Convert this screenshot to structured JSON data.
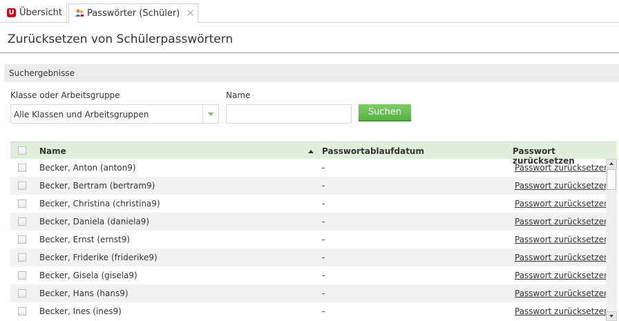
{
  "tabs": {
    "overview_label": "Übersicht",
    "passwords_label": "Passwörter (Schüler)",
    "close_symbol": "✕"
  },
  "page_title": "Zurücksetzen von Schülerpasswörtern",
  "section_title": "Suchergebnisse",
  "filter": {
    "class_label": "Klasse oder Arbeitsgruppe",
    "class_value": "Alle Klassen und Arbeitsgruppen",
    "name_label": "Name",
    "name_value": "",
    "search_button": "Suchen"
  },
  "grid": {
    "columns": {
      "name": "Name",
      "expiry": "Passwortablaufdatum",
      "reset": "Passwort zurücksetzen"
    },
    "rows": [
      {
        "name": "Becker, Anton (anton9)",
        "expiry": "-",
        "action": "Passwort zurücksetzen"
      },
      {
        "name": "Becker, Bertram (bertram9)",
        "expiry": "-",
        "action": "Passwort zurücksetzen"
      },
      {
        "name": "Becker, Christina (christina9)",
        "expiry": "-",
        "action": "Passwort zurücksetzen"
      },
      {
        "name": "Becker, Daniela (daniela9)",
        "expiry": "-",
        "action": "Passwort zurücksetzen"
      },
      {
        "name": "Becker, Ernst (ernst9)",
        "expiry": "-",
        "action": "Passwort zurücksetzen"
      },
      {
        "name": "Becker, Friderike (friderike9)",
        "expiry": "-",
        "action": "Passwort zurücksetzen"
      },
      {
        "name": "Becker, Gisela (gisela9)",
        "expiry": "-",
        "action": "Passwort zurücksetzen"
      },
      {
        "name": "Becker, Hans (hans9)",
        "expiry": "-",
        "action": "Passwort zurücksetzen"
      },
      {
        "name": "Becker, Ines (ines9)",
        "expiry": "-",
        "action": "Passwort zurücksetzen"
      }
    ]
  },
  "colors": {
    "accent_green": "#57b142",
    "header_green": "#e0efd9",
    "brand_red": "#d0021b"
  },
  "icons": {
    "overview": "univention-logo-icon",
    "passwords": "users-key-icon"
  }
}
